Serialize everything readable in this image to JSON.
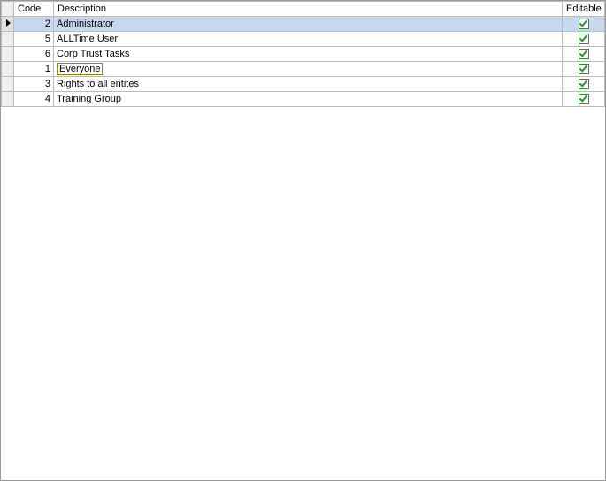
{
  "columns": {
    "code": "Code",
    "description": "Description",
    "editable": "Editable"
  },
  "rows": [
    {
      "code": "2",
      "description": "Administrator",
      "editable": true,
      "selected": true,
      "focused": false
    },
    {
      "code": "5",
      "description": "ALLTime User",
      "editable": true,
      "selected": false,
      "focused": false
    },
    {
      "code": "6",
      "description": "Corp Trust Tasks",
      "editable": true,
      "selected": false,
      "focused": false
    },
    {
      "code": "1",
      "description": "Everyone",
      "editable": true,
      "selected": false,
      "focused": true
    },
    {
      "code": "3",
      "description": "Rights to all entites",
      "editable": true,
      "selected": false,
      "focused": false
    },
    {
      "code": "4",
      "description": "Training Group",
      "editable": true,
      "selected": false,
      "focused": false
    }
  ]
}
